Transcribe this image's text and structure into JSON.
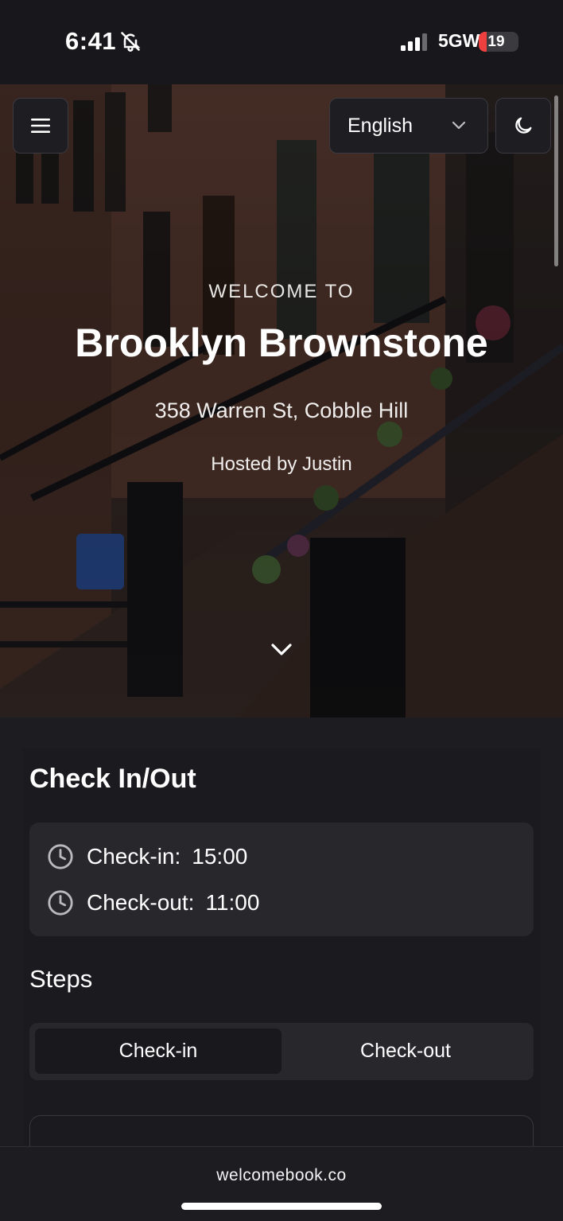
{
  "status_bar": {
    "time": "6:41",
    "network": "5GW",
    "battery_level": "19",
    "battery_fraction": 0.19,
    "icons": [
      "bell-slash-icon",
      "signal-bars-icon",
      "battery-icon"
    ]
  },
  "hero": {
    "language": "English",
    "eyebrow": "WELCOME TO",
    "title": "Brooklyn Brownstone",
    "address": "358 Warren St, Cobble Hill",
    "host": "Hosted by Justin",
    "icons": [
      "menu-icon",
      "chevron-down-icon",
      "moon-icon",
      "scroll-down-icon"
    ]
  },
  "checkinout": {
    "title": "Check In/Out",
    "checkin_label": "Check-in:",
    "checkin_time": "15:00",
    "checkout_label": "Check-out:",
    "checkout_time": "11:00"
  },
  "steps": {
    "title": "Steps",
    "tabs": [
      {
        "label": "Check-in",
        "active": true
      },
      {
        "label": "Check-out",
        "active": false
      }
    ]
  },
  "footer": {
    "site": "welcomebook.co"
  },
  "colors": {
    "background": "#1c1c21",
    "card": "#27272c",
    "battery_low": "#ef4040"
  }
}
